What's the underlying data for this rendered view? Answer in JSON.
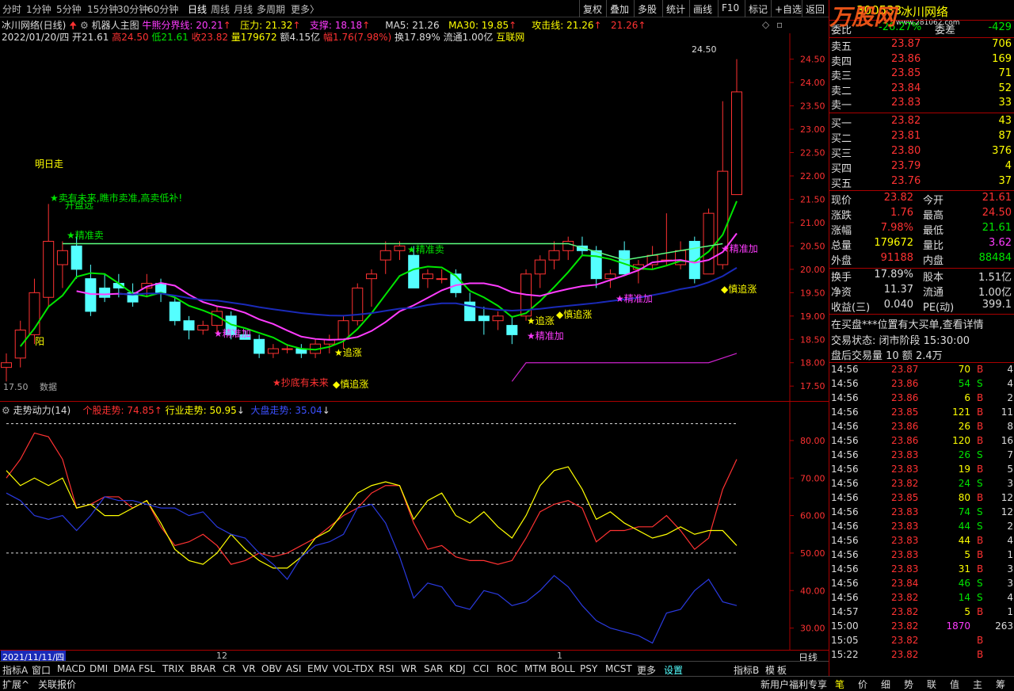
{
  "topbar": {
    "periods": [
      "分时",
      "1分钟",
      "5分钟",
      "15分钟",
      "30分钟",
      "60分钟",
      "日线",
      "周线",
      "月线",
      "多周期",
      "更多〉"
    ],
    "active": "日线",
    "right_buttons": [
      "复权",
      "叠加",
      "多股",
      "统计",
      "画线",
      "F10",
      "标记",
      "+自选",
      "返回"
    ]
  },
  "chart": {
    "stock_title": "冰川网络(日线)",
    "robot": "机器人主图",
    "bull_line_label": "牛熊分界线: 20.21",
    "pressure": "压力: 21.32",
    "support": "支撑: 18.18",
    "ma5": "MA5: 21.26",
    "ma30": "MA30: 19.85",
    "attack": "攻击线: 21.26",
    "attack2": "21.26",
    "date": "2022/01/20/四",
    "open": "开21.61",
    "high": "高24.50",
    "low": "低21.61",
    "close": "收23.82",
    "vol": "量179672",
    "amount": "额4.15亿",
    "change": "幅1.76(7.98%)",
    "turnover": "换17.89%",
    "float": "流通1.00亿",
    "sector": "互联网",
    "peak_label": "24.50",
    "low_label": "17.50",
    "bottom_label": "数据",
    "price_ticks": [
      "24.50",
      "24.00",
      "23.50",
      "23.00",
      "22.50",
      "22.00",
      "21.50",
      "21.00",
      "20.50",
      "20.00",
      "19.50",
      "19.00",
      "18.50",
      "18.00",
      "17.50"
    ],
    "annotations": [
      "明日走",
      "★卖有未来,瞧市卖准,高卖低补!",
      "开盘远",
      "★精准卖",
      "★精准卖",
      "★精准加",
      "★追涨",
      "★抄底有未来",
      "◆慎追涨",
      "★追涨",
      "◆慎追涨",
      "★精准加",
      "★精准加",
      "★精准加",
      "◆慎追涨",
      "阳"
    ]
  },
  "chart_data": {
    "type": "candlestick",
    "ylim": [
      17.3,
      24.8
    ],
    "candles": [
      [
        17.9,
        18.2,
        17.6,
        18.0
      ],
      [
        18.1,
        18.9,
        17.9,
        18.7
      ],
      [
        18.6,
        19.8,
        18.4,
        19.5
      ],
      [
        19.4,
        21.4,
        19.2,
        20.6
      ],
      [
        20.1,
        20.6,
        19.6,
        20.4
      ],
      [
        20.5,
        20.7,
        19.8,
        20.0
      ],
      [
        19.8,
        20.1,
        19.0,
        19.1
      ],
      [
        19.6,
        19.9,
        19.3,
        19.4
      ],
      [
        19.7,
        19.9,
        19.4,
        19.6
      ],
      [
        19.5,
        19.7,
        19.2,
        19.3
      ],
      [
        19.6,
        19.9,
        19.4,
        19.7
      ],
      [
        19.7,
        19.8,
        19.3,
        19.5
      ],
      [
        19.3,
        19.4,
        18.8,
        18.9
      ],
      [
        18.9,
        19.0,
        18.5,
        18.7
      ],
      [
        18.7,
        18.9,
        18.6,
        18.8
      ],
      [
        18.8,
        19.2,
        18.6,
        19.1
      ],
      [
        19.0,
        19.1,
        18.5,
        18.6
      ],
      [
        18.6,
        18.7,
        18.5,
        18.5
      ],
      [
        18.5,
        18.6,
        18.1,
        18.2
      ],
      [
        18.2,
        18.4,
        18.1,
        18.3
      ],
      [
        18.3,
        18.4,
        18.2,
        18.3
      ],
      [
        18.3,
        18.4,
        18.1,
        18.2
      ],
      [
        18.2,
        18.5,
        18.1,
        18.4
      ],
      [
        18.4,
        18.6,
        18.2,
        18.5
      ],
      [
        18.5,
        19.0,
        18.3,
        18.9
      ],
      [
        18.9,
        19.7,
        18.8,
        19.6
      ],
      [
        19.8,
        20.0,
        19.2,
        19.9
      ],
      [
        20.2,
        20.6,
        19.9,
        20.4
      ],
      [
        20.4,
        20.6,
        20.2,
        20.5
      ],
      [
        20.3,
        20.5,
        19.7,
        19.6
      ],
      [
        19.8,
        20.0,
        19.6,
        19.9
      ],
      [
        19.8,
        20.0,
        19.7,
        19.8
      ],
      [
        19.9,
        20.0,
        19.4,
        19.5
      ],
      [
        19.3,
        19.5,
        18.9,
        18.9
      ],
      [
        19.0,
        19.2,
        18.6,
        18.9
      ],
      [
        18.9,
        19.1,
        18.7,
        19.0
      ],
      [
        18.8,
        19.0,
        18.4,
        18.6
      ],
      [
        19.0,
        20.0,
        18.9,
        19.9
      ],
      [
        19.9,
        20.3,
        19.6,
        20.2
      ],
      [
        20.2,
        20.6,
        20.0,
        20.4
      ],
      [
        20.4,
        20.7,
        20.2,
        20.6
      ],
      [
        20.5,
        20.7,
        20.3,
        20.4
      ],
      [
        20.4,
        20.5,
        19.6,
        19.8
      ],
      [
        19.8,
        20.0,
        19.6,
        19.9
      ],
      [
        20.4,
        20.6,
        19.9,
        19.9
      ],
      [
        20.0,
        20.2,
        19.7,
        20.1
      ],
      [
        20.1,
        20.5,
        20.0,
        20.3
      ],
      [
        20.2,
        21.2,
        20.1,
        20.2
      ],
      [
        20.1,
        20.6,
        20.0,
        20.4
      ],
      [
        20.6,
        20.7,
        19.7,
        19.8
      ],
      [
        19.9,
        21.3,
        19.9,
        21.2
      ],
      [
        20.1,
        23.6,
        20.0,
        22.1
      ],
      [
        21.6,
        24.5,
        21.6,
        23.8
      ]
    ]
  },
  "sub": {
    "title": "走势动力(14)",
    "stock_trend": "个股走势: 74.85",
    "industry_trend": "行业走势: 50.95",
    "market_trend": "大盘走势: 35.04",
    "ticks": [
      "80.00",
      "70.00",
      "60.00",
      "50.00",
      "40.00",
      "30.00"
    ]
  },
  "xaxis": {
    "date": "2021/11/11/四",
    "m12": "12",
    "m1": "1",
    "period": "日线"
  },
  "bottom_tabs": [
    "指标A",
    "窗口",
    "MACD",
    "DMI",
    "DMA",
    "FSL",
    "TRIX",
    "BRAR",
    "CR",
    "VR",
    "OBV",
    "ASI",
    "EMV",
    "VOL-TDX",
    "RSI",
    "WR",
    "SAR",
    "KDJ",
    "CCI",
    "ROC",
    "MTM",
    "BOLL",
    "PSY",
    "MCST",
    "更多",
    "设置"
  ],
  "bottom_right": [
    "指标B",
    "模",
    "板"
  ],
  "status": {
    "expand": "扩展^",
    "link": "关联报价",
    "news": "新用户福利专享"
  },
  "quote": {
    "code": "300533",
    "name": "冰川网络",
    "weibi_label": "委比",
    "weibi": "-26.27%",
    "weicha_label": "委差",
    "weicha": "-429",
    "asks": [
      {
        "label": "卖五",
        "price": "23.87",
        "vol": "706"
      },
      {
        "label": "卖四",
        "price": "23.86",
        "vol": "169"
      },
      {
        "label": "卖三",
        "price": "23.85",
        "vol": "71"
      },
      {
        "label": "卖二",
        "price": "23.84",
        "vol": "52"
      },
      {
        "label": "卖一",
        "price": "23.83",
        "vol": "33"
      }
    ],
    "bids": [
      {
        "label": "买一",
        "price": "23.82",
        "vol": "43"
      },
      {
        "label": "买二",
        "price": "23.81",
        "vol": "87"
      },
      {
        "label": "买三",
        "price": "23.80",
        "vol": "376"
      },
      {
        "label": "买四",
        "price": "23.79",
        "vol": "4"
      },
      {
        "label": "买五",
        "price": "23.76",
        "vol": "37"
      }
    ],
    "stats": [
      {
        "l1": "现价",
        "v1": "23.82",
        "l2": "今开",
        "v2": "21.61"
      },
      {
        "l1": "涨跌",
        "v1": "1.76",
        "l2": "最高",
        "v2": "24.50"
      },
      {
        "l1": "涨幅",
        "v1": "7.98%",
        "l2": "最低",
        "v2": "21.61"
      },
      {
        "l1": "总量",
        "v1": "179672",
        "l2": "量比",
        "v2": "3.62"
      },
      {
        "l1": "外盘",
        "v1": "91188",
        "l2": "内盘",
        "v2": "88484"
      }
    ],
    "stats2": [
      {
        "l1": "换手",
        "v1": "17.89%",
        "l2": "股本",
        "v2": "1.51亿"
      },
      {
        "l1": "净资",
        "v1": "11.37",
        "l2": "流通",
        "v2": "1.00亿"
      },
      {
        "l1": "收益(三)",
        "v1": "0.040",
        "l2": "PE(动)",
        "v2": "399.1"
      }
    ],
    "notice": "在买盘***位置有大买单,查看详情",
    "trade_state": "交易状态: 闭市阶段 15:30:00",
    "after_hours": "盘后交易量 10 额 2.4万",
    "ticks": [
      {
        "t": "14:56",
        "p": "23.87",
        "v": "70",
        "s": "B",
        "n": "4"
      },
      {
        "t": "14:56",
        "p": "23.86",
        "v": "54",
        "s": "S",
        "n": "4"
      },
      {
        "t": "14:56",
        "p": "23.86",
        "v": "6",
        "s": "B",
        "n": "2"
      },
      {
        "t": "14:56",
        "p": "23.85",
        "v": "121",
        "s": "B",
        "n": "11"
      },
      {
        "t": "14:56",
        "p": "23.86",
        "v": "26",
        "s": "B",
        "n": "8"
      },
      {
        "t": "14:56",
        "p": "23.86",
        "v": "120",
        "s": "B",
        "n": "16"
      },
      {
        "t": "14:56",
        "p": "23.83",
        "v": "26",
        "s": "S",
        "n": "7"
      },
      {
        "t": "14:56",
        "p": "23.83",
        "v": "19",
        "s": "B",
        "n": "5"
      },
      {
        "t": "14:56",
        "p": "23.82",
        "v": "24",
        "s": "S",
        "n": "3"
      },
      {
        "t": "14:56",
        "p": "23.85",
        "v": "80",
        "s": "B",
        "n": "12"
      },
      {
        "t": "14:56",
        "p": "23.83",
        "v": "74",
        "s": "S",
        "n": "12"
      },
      {
        "t": "14:56",
        "p": "23.83",
        "v": "44",
        "s": "S",
        "n": "2"
      },
      {
        "t": "14:56",
        "p": "23.83",
        "v": "44",
        "s": "B",
        "n": "4"
      },
      {
        "t": "14:56",
        "p": "23.83",
        "v": "5",
        "s": "B",
        "n": "1"
      },
      {
        "t": "14:56",
        "p": "23.83",
        "v": "31",
        "s": "B",
        "n": "3"
      },
      {
        "t": "14:56",
        "p": "23.84",
        "v": "46",
        "s": "S",
        "n": "3"
      },
      {
        "t": "14:56",
        "p": "23.82",
        "v": "14",
        "s": "S",
        "n": "4"
      },
      {
        "t": "14:57",
        "p": "23.82",
        "v": "5",
        "s": "B",
        "n": "1"
      },
      {
        "t": "15:00",
        "p": "23.82",
        "v": "1870",
        "s": "",
        "n": "263"
      },
      {
        "t": "15:05",
        "p": "23.82",
        "v": "",
        "s": "B",
        "n": ""
      },
      {
        "t": "15:22",
        "p": "23.82",
        "v": "",
        "s": "B",
        "n": ""
      }
    ],
    "bottom_tabs": [
      "笔",
      "价",
      "细",
      "势",
      "联",
      "值",
      "主",
      "筹"
    ],
    "watermark": "万股网",
    "watermark_url": "www.281062.com"
  }
}
